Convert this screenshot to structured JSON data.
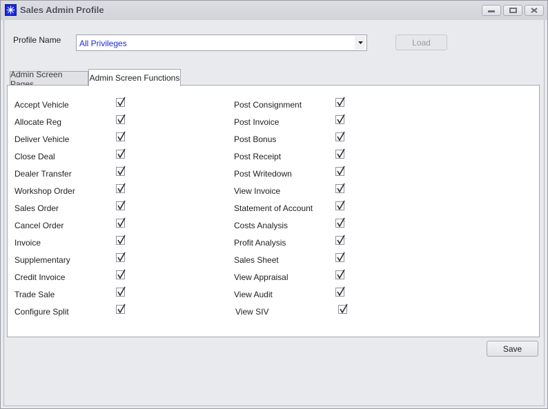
{
  "window": {
    "title": "Sales Admin Profile",
    "icon": "snowflake-compass-icon",
    "controls": [
      "minimize",
      "maximize",
      "close"
    ]
  },
  "profile": {
    "label": "Profile Name",
    "selected_value": "All Privileges",
    "load_label": "Load",
    "load_enabled": false
  },
  "tabs": [
    {
      "label": "Admin Screen Pages",
      "active": false
    },
    {
      "label": "Admin Screen Functions",
      "active": true
    }
  ],
  "functions": {
    "left": [
      {
        "label": "Accept Vehicle",
        "checked": true
      },
      {
        "label": "Allocate Reg",
        "checked": true
      },
      {
        "label": "Deliver Vehicle",
        "checked": true
      },
      {
        "label": "Close Deal",
        "checked": true
      },
      {
        "label": "Dealer Transfer",
        "checked": true
      },
      {
        "label": "Workshop Order",
        "checked": true
      },
      {
        "label": "Sales Order",
        "checked": true
      },
      {
        "label": "Cancel Order",
        "checked": true
      },
      {
        "label": "Invoice",
        "checked": true
      },
      {
        "label": "Supplementary",
        "checked": true
      },
      {
        "label": "Credit Invoice",
        "checked": true
      },
      {
        "label": "Trade Sale",
        "checked": true
      },
      {
        "label": "Configure Split",
        "checked": true
      }
    ],
    "right": [
      {
        "label": "Post Consignment",
        "checked": true
      },
      {
        "label": "Post Invoice",
        "checked": true
      },
      {
        "label": "Post Bonus",
        "checked": true
      },
      {
        "label": "Post Receipt",
        "checked": true
      },
      {
        "label": "Post Writedown",
        "checked": true
      },
      {
        "label": "View Invoice",
        "checked": true
      },
      {
        "label": "Statement of Account",
        "checked": true
      },
      {
        "label": "Costs Analysis",
        "checked": true
      },
      {
        "label": "Profit Analysis",
        "checked": true
      },
      {
        "label": "Sales Sheet",
        "checked": true
      },
      {
        "label": "View Appraisal",
        "checked": true
      },
      {
        "label": "View Audit",
        "checked": true
      },
      {
        "label": "View SIV",
        "checked": true
      }
    ]
  },
  "footer": {
    "save_label": "Save"
  },
  "colors": {
    "accent_text": "#1d28d8",
    "window_bg": "#e9eaee",
    "icon_blue": "#1a28e0"
  }
}
